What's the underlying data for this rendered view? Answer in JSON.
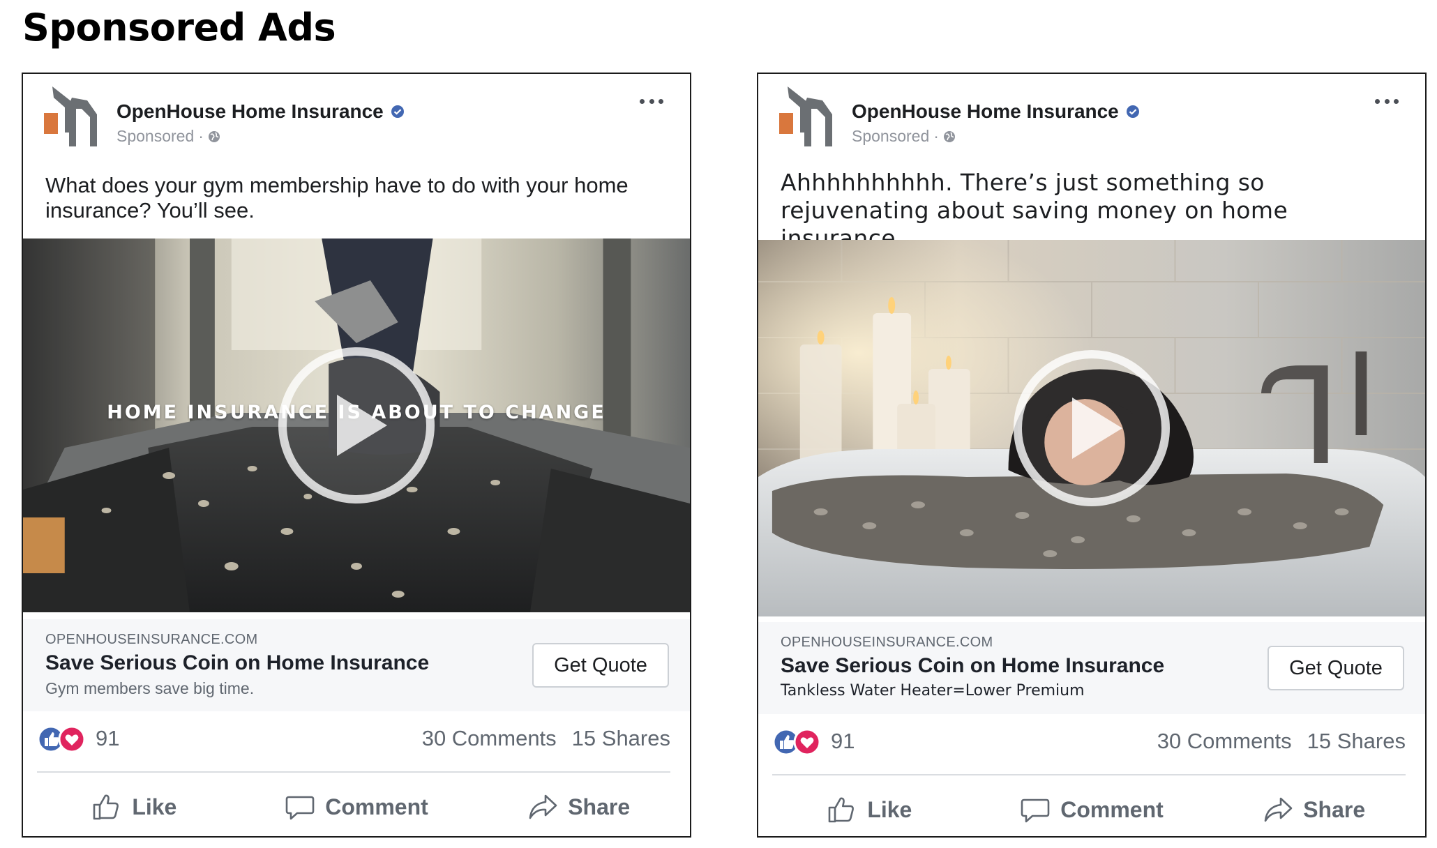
{
  "page": {
    "title": "Sponsored Ads"
  },
  "colors": {
    "facebook_blue": "#4267b2",
    "love_red": "#e0245e",
    "logo_orange": "#d9773d",
    "logo_gray": "#6b6f73",
    "meta_gray": "#90949c"
  },
  "ads": [
    {
      "page_name": "OpenHouse Home Insurance",
      "sponsored_label": "Sponsored",
      "meta_separator": "·",
      "verified_icon": "verified-badge-icon",
      "menu_icon": "more-options-icon",
      "post_text": "What does your gym membership have to do with your home insurance? You’ll see.",
      "video": {
        "scene": "treadmill with coins",
        "overlay_caption": "HOME INSURANCE IS ABOUT TO CHANGE",
        "play_icon": "play-icon"
      },
      "link": {
        "domain": "OPENHOUSEINSURANCE.COM",
        "headline": "Save Serious Coin on Home Insurance",
        "description": "Gym members save big time.",
        "cta": "Get Quote"
      },
      "reactions": {
        "count": "91",
        "icons": [
          "like-reaction-icon",
          "love-reaction-icon"
        ]
      },
      "comments": "30 Comments",
      "shares": "15 Shares",
      "actions": {
        "like": "Like",
        "comment": "Comment",
        "share": "Share"
      }
    },
    {
      "page_name": "OpenHouse Home Insurance",
      "sponsored_label": "Sponsored",
      "meta_separator": "·",
      "verified_icon": "verified-badge-icon",
      "menu_icon": "more-options-icon",
      "post_text": "Ahhhhhhhhhh. There’s just something so rejuvenating about saving money on home insurance.",
      "video": {
        "scene": "woman in bathtub full of coins",
        "overlay_caption": "",
        "play_icon": "play-icon"
      },
      "link": {
        "domain": "OPENHOUSEINSURANCE.COM",
        "headline": "Save Serious Coin on Home Insurance",
        "description": "Tankless Water Heater=Lower Premium",
        "cta": "Get Quote"
      },
      "reactions": {
        "count": "91",
        "icons": [
          "like-reaction-icon",
          "love-reaction-icon"
        ]
      },
      "comments": "30 Comments",
      "shares": "15 Shares",
      "actions": {
        "like": "Like",
        "comment": "Comment",
        "share": "Share"
      }
    }
  ]
}
